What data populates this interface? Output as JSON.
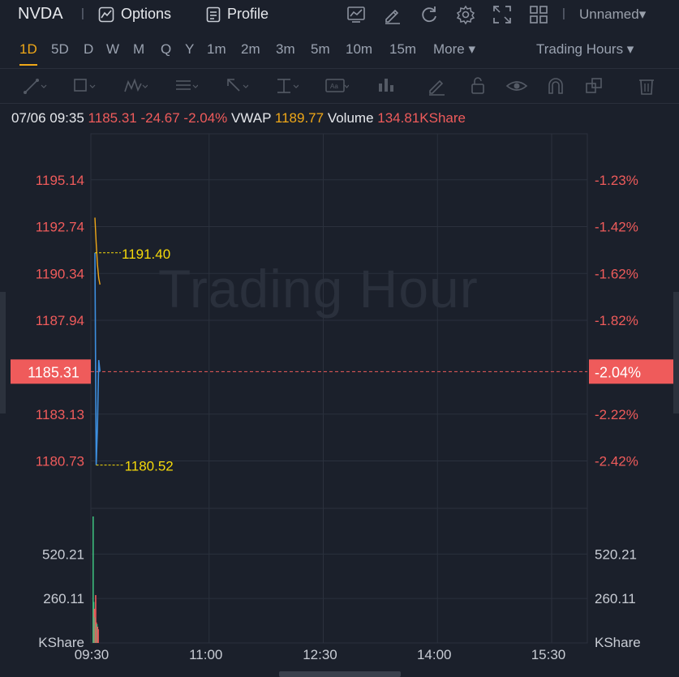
{
  "header": {
    "symbol": "NVDA",
    "separator": "|",
    "options_label": "Options",
    "profile_label": "Profile",
    "layout_name": "Unnamed▾",
    "icons": [
      "compare-icon",
      "edit-icon",
      "refresh-icon",
      "settings-icon",
      "fullscreen-icon",
      "grid-icon"
    ]
  },
  "timeframes": {
    "items": [
      "1D",
      "5D",
      "D",
      "W",
      "M",
      "Q",
      "Y",
      "1m",
      "2m",
      "3m",
      "5m",
      "10m",
      "15m",
      "More ▾"
    ],
    "active": "1D",
    "session": "Trading Hours ▾"
  },
  "drawing_tools": [
    "line-tool-icon",
    "rectangle-tool-icon",
    "pattern-tool-icon",
    "fib-tool-icon",
    "arrow-tool-icon",
    "measure-tool-icon",
    "text-tool-icon",
    "bars-tool-icon",
    "pen-icon",
    "lock-icon",
    "eye-icon",
    "magnet-icon",
    "layers-icon",
    "trash-icon"
  ],
  "info": {
    "datetime": "07/06 09:35",
    "price": "1185.31",
    "change": "-24.67",
    "change_pct": "-2.04%",
    "vwap_label": "VWAP",
    "vwap": "1189.77",
    "volume_label": "Volume",
    "volume": "134.81KShare"
  },
  "watermark": "Trading Hour",
  "colors": {
    "background": "#1b202b",
    "price_line": "#3d8fe0",
    "vwap_line": "#f0a818",
    "up": "#ef5b5b",
    "down": "#3dbb7c",
    "marker_text": "#f5d90a"
  },
  "chart_data": {
    "type": "line",
    "x_ticks": [
      "09:30",
      "11:00",
      "12:30",
      "14:00",
      "15:30"
    ],
    "x_tick_minutes": [
      0,
      90,
      180,
      270,
      360
    ],
    "session_minutes": 390,
    "price": {
      "ylim": [
        1178.3,
        1197.5
      ],
      "left_ticks": [
        "1195.14",
        "1192.74",
        "1190.34",
        "1187.94",
        "1183.13",
        "1180.73"
      ],
      "left_tick_values": [
        1195.14,
        1192.74,
        1190.34,
        1187.94,
        1183.13,
        1180.73
      ],
      "right_ticks": [
        "-1.23%",
        "-1.42%",
        "-1.62%",
        "-1.82%",
        "-2.22%",
        "-2.42%"
      ],
      "current": 1185.31,
      "current_label": "1185.31",
      "current_pct": "-2.04%",
      "high": 1191.4,
      "high_label": "1191.40",
      "low": 1180.52,
      "low_label": "1180.52",
      "series": [
        {
          "x": 0,
          "y": 1191.4
        },
        {
          "x": 1,
          "y": 1180.52
        },
        {
          "x": 2,
          "y": 1182.5
        },
        {
          "x": 3,
          "y": 1185.9
        },
        {
          "x": 4,
          "y": 1185.31
        }
      ],
      "vwap_series": [
        {
          "x": 0,
          "y": 1193.2
        },
        {
          "x": 1,
          "y": 1191.9
        },
        {
          "x": 2,
          "y": 1190.8
        },
        {
          "x": 3,
          "y": 1190.1
        },
        {
          "x": 4,
          "y": 1189.77
        }
      ]
    },
    "volume": {
      "ylim": [
        0,
        740
      ],
      "ticks": [
        "520.21",
        "260.11"
      ],
      "tick_values": [
        520.21,
        260.11
      ],
      "unit": "KShare",
      "bars": [
        {
          "x": 0,
          "v": 740,
          "dir": "down"
        },
        {
          "x": 0.5,
          "v": 240,
          "dir": "down"
        },
        {
          "x": 1,
          "v": 200,
          "dir": "up"
        },
        {
          "x": 1.5,
          "v": 150,
          "dir": "down"
        },
        {
          "x": 2,
          "v": 280,
          "dir": "up"
        },
        {
          "x": 2.5,
          "v": 120,
          "dir": "up"
        },
        {
          "x": 3,
          "v": 110,
          "dir": "down"
        },
        {
          "x": 3.5,
          "v": 95,
          "dir": "up"
        },
        {
          "x": 4,
          "v": 80,
          "dir": "up"
        }
      ]
    }
  }
}
